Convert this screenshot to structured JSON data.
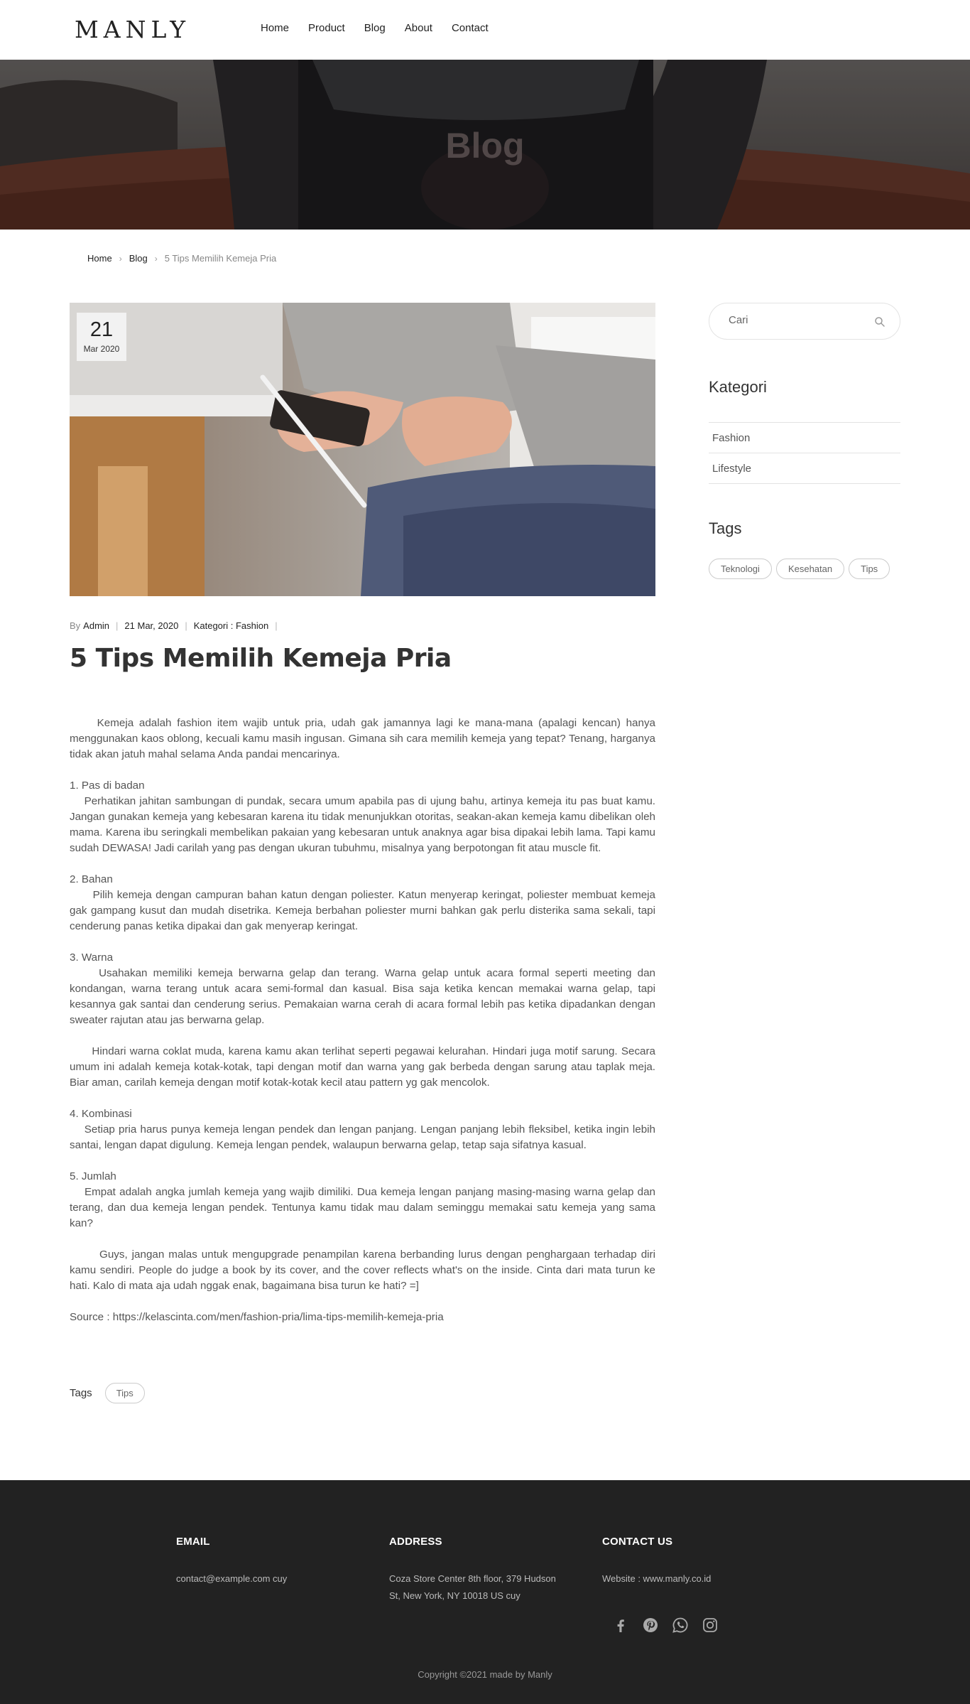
{
  "header": {
    "logo": "MANLY",
    "nav": [
      "Home",
      "Product",
      "Blog",
      "About",
      "Contact"
    ]
  },
  "hero": {
    "title": "Blog"
  },
  "breadcrumb": {
    "home": "Home",
    "blog": "Blog",
    "current": "5 Tips Memilih Kemeja Pria"
  },
  "post": {
    "date_day": "21",
    "date_month": "Mar 2020",
    "meta_by": "By",
    "meta_author": "Admin",
    "meta_date": "21 Mar, 2020",
    "meta_category": "Kategori : Fashion",
    "title": "5 Tips Memilih Kemeja Pria",
    "paragraphs": [
      "     Kemeja adalah fashion item wajib untuk pria, udah gak jamannya lagi ke mana-mana (apalagi kencan) hanya menggunakan kaos oblong, kecuali kamu masih ingusan. Gimana sih cara memilih kemeja yang tepat? Tenang, harganya tidak akan jatuh mahal selama Anda pandai mencarinya.",
      "1. Pas di badan\n    Perhatikan jahitan sambungan di pundak, secara umum apabila pas di ujung bahu, artinya kemeja itu pas buat kamu. Jangan gunakan kemeja yang kebesaran karena itu tidak menunjukkan otoritas, seakan-akan kemeja kamu dibelikan oleh mama. Karena ibu seringkali membelikan pakaian yang kebesaran untuk anaknya agar bisa dipakai lebih lama. Tapi kamu sudah DEWASA! Jadi carilah yang pas dengan ukuran tubuhmu, misalnya yang berpotongan fit atau muscle fit.",
      "2. Bahan\n      Pilih kemeja dengan campuran bahan katun dengan poliester. Katun menyerap keringat, poliester membuat kemeja gak gampang kusut dan mudah disetrika. Kemeja berbahan poliester murni bahkan gak perlu disterika sama sekali, tapi cenderung panas ketika dipakai dan gak menyerap keringat.",
      "3. Warna\n     Usahakan memiliki kemeja berwarna gelap dan terang. Warna gelap untuk acara formal seperti meeting dan kondangan, warna terang untuk acara semi-formal dan kasual. Bisa saja ketika kencan memakai warna gelap, tapi kesannya gak santai dan cenderung serius. Pemakaian warna cerah di acara formal lebih pas ketika dipadankan dengan sweater rajutan atau jas berwarna gelap.",
      "      Hindari warna coklat muda, karena kamu akan terlihat seperti pegawai kelurahan. Hindari juga motif sarung. Secara umum ini adalah kemeja kotak-kotak, tapi dengan motif dan warna yang gak berbeda dengan sarung atau taplak meja. Biar aman, carilah kemeja dengan motif kotak-kotak kecil atau pattern yg gak mencolok.",
      "4. Kombinasi\n    Setiap pria harus punya kemeja lengan pendek dan lengan panjang. Lengan panjang lebih fleksibel, ketika ingin lebih santai, lengan dapat digulung. Kemeja lengan pendek, walaupun berwarna gelap, tetap saja sifatnya kasual.",
      "5. Jumlah\n    Empat adalah angka jumlah kemeja yang wajib dimiliki. Dua kemeja lengan panjang masing-masing warna gelap dan terang, dan dua kemeja lengan pendek. Tentunya kamu tidak mau dalam seminggu memakai satu kemeja yang sama kan?",
      "       Guys, jangan malas untuk mengupgrade penampilan karena berbanding lurus dengan penghargaan terhadap diri kamu sendiri. People do judge a book by its cover, and the cover reflects what's on the inside. Cinta dari mata turun ke hati. Kalo di mata aja udah nggak enak, bagaimana bisa turun ke hati? =]"
    ],
    "source": "Source : https://kelascinta.com/men/fashion-pria/lima-tips-memilih-kemeja-pria",
    "tags_label": "Tags",
    "tags": [
      "Tips"
    ]
  },
  "sidebar": {
    "search_placeholder": "Cari",
    "categories_heading": "Kategori",
    "categories": [
      "Fashion",
      "Lifestyle"
    ],
    "tags_heading": "Tags",
    "tags": [
      "Teknologi",
      "Kesehatan",
      "Tips"
    ]
  },
  "footer": {
    "email_heading": "EMAIL",
    "email": "contact@example.com cuy",
    "address_heading": "ADDRESS",
    "address_line1": "Coza Store Center 8th floor, 379 Hudson",
    "address_line2": "St, New York, NY 10018 US cuy",
    "contact_heading": "CONTACT US",
    "website": "Website : www.manly.co.id",
    "copyright": "Copyright ©2021 made by Manly"
  },
  "icons": [
    "facebook-icon",
    "pinterest-icon",
    "whatsapp-icon",
    "instagram-icon",
    "search-icon"
  ]
}
